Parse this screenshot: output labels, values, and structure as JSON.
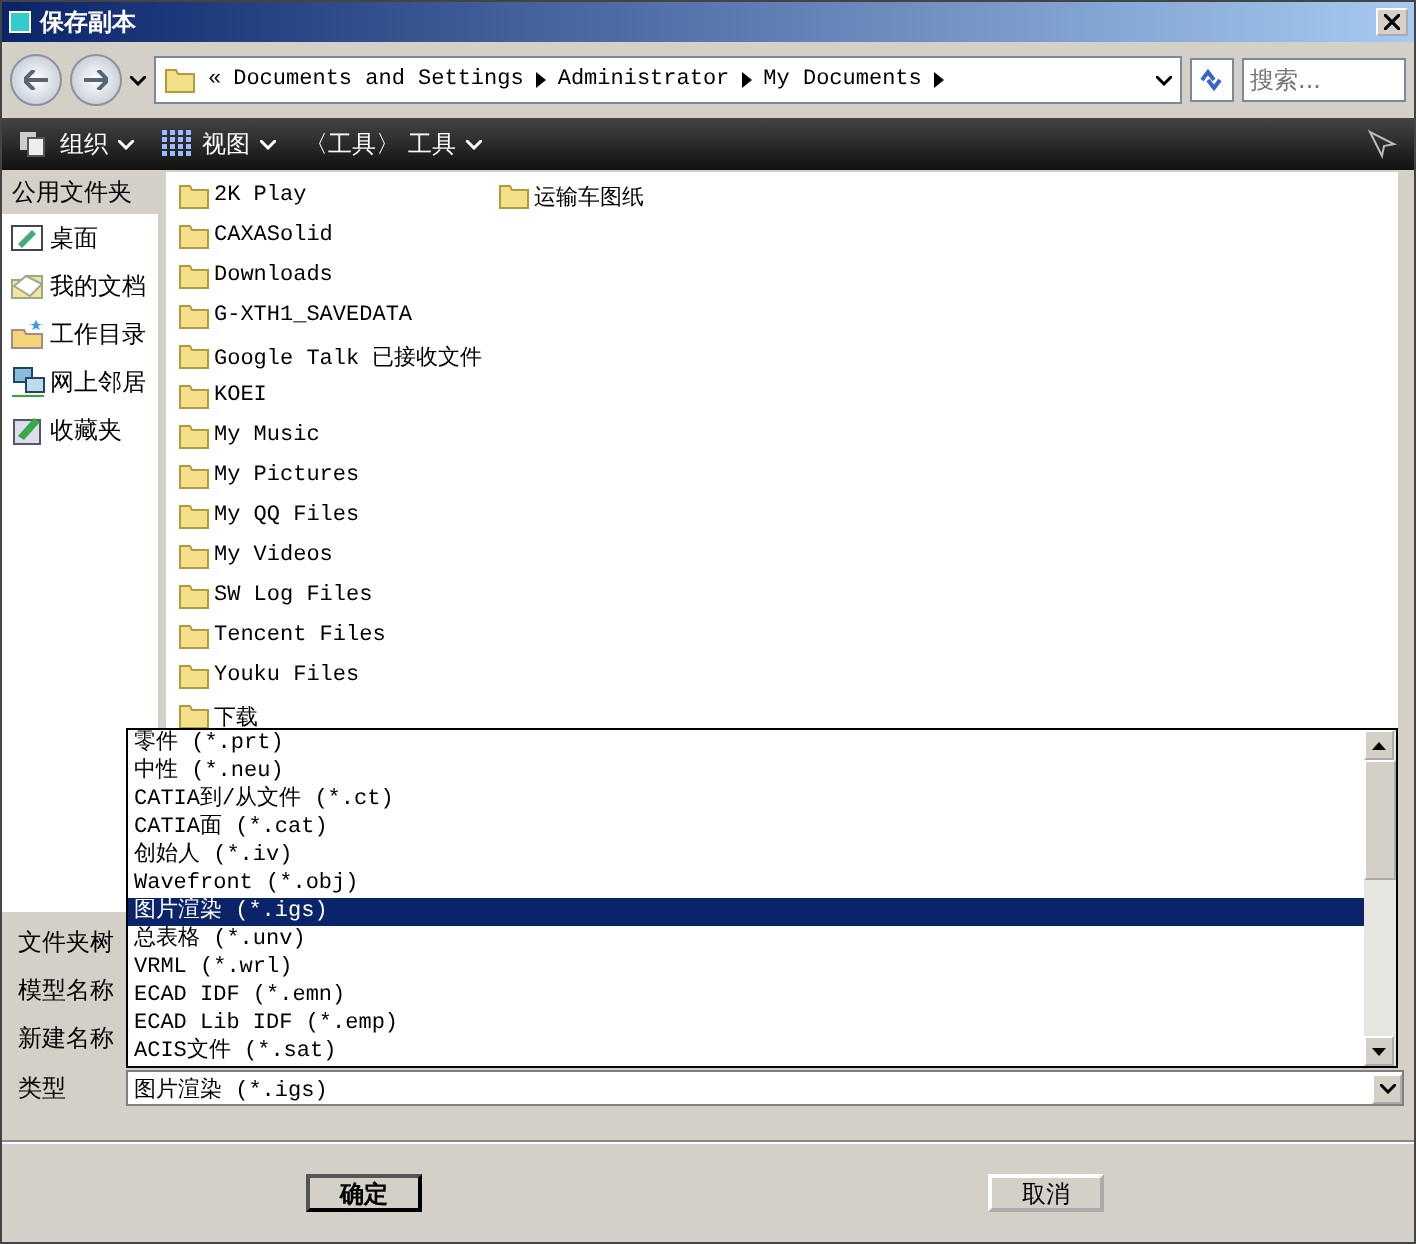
{
  "window": {
    "title": "保存副本"
  },
  "address": {
    "overflow": "«",
    "crumbs": [
      "Documents and Settings",
      "Administrator",
      "My Documents"
    ]
  },
  "search": {
    "placeholder": "搜索..."
  },
  "toolbar": [
    {
      "label": "组织",
      "kind": "organize"
    },
    {
      "label": "视图",
      "kind": "views"
    },
    {
      "label": "〈工具〉 工具",
      "kind": "tools"
    }
  ],
  "sidebar": {
    "title": "公用文件夹",
    "items": [
      {
        "label": "桌面",
        "kind": "desktop"
      },
      {
        "label": "我的文档",
        "kind": "documents"
      },
      {
        "label": "工作目录",
        "kind": "workdir"
      },
      {
        "label": "网上邻居",
        "kind": "network"
      },
      {
        "label": "收藏夹",
        "kind": "favorites"
      }
    ]
  },
  "files": [
    "2K Play",
    "CAXASolid",
    "Downloads",
    "G-XTH1_SAVEDATA",
    "Google Talk 已接收文件",
    "KOEI",
    "My Music",
    "My Pictures",
    "My QQ Files",
    "My Videos",
    "SW Log Files",
    "Tencent Files",
    "Youku Files",
    "下载",
    "运输车图纸"
  ],
  "form": {
    "labels": [
      "文件夹树",
      "模型名称",
      "新建名称"
    ],
    "type_label": "类型",
    "type_value": "图片渲染 (*.igs)"
  },
  "type_options": [
    {
      "label": "零件 (*.prt)",
      "selected": false
    },
    {
      "label": "中性 (*.neu)",
      "selected": false
    },
    {
      "label": "CATIA到/从文件 (*.ct)",
      "selected": false
    },
    {
      "label": "CATIA面 (*.cat)",
      "selected": false
    },
    {
      "label": "创始人 (*.iv)",
      "selected": false
    },
    {
      "label": "Wavefront (*.obj)",
      "selected": false
    },
    {
      "label": "图片渲染 (*.igs)",
      "selected": true
    },
    {
      "label": "总表格 (*.unv)",
      "selected": false
    },
    {
      "label": "VRML (*.wrl)",
      "selected": false
    },
    {
      "label": "ECAD IDF (*.emn)",
      "selected": false
    },
    {
      "label": "ECAD Lib IDF (*.emp)",
      "selected": false
    },
    {
      "label": "ACIS文件 (*.sat)",
      "selected": false
    }
  ],
  "buttons": [
    "确定",
    "取消"
  ]
}
